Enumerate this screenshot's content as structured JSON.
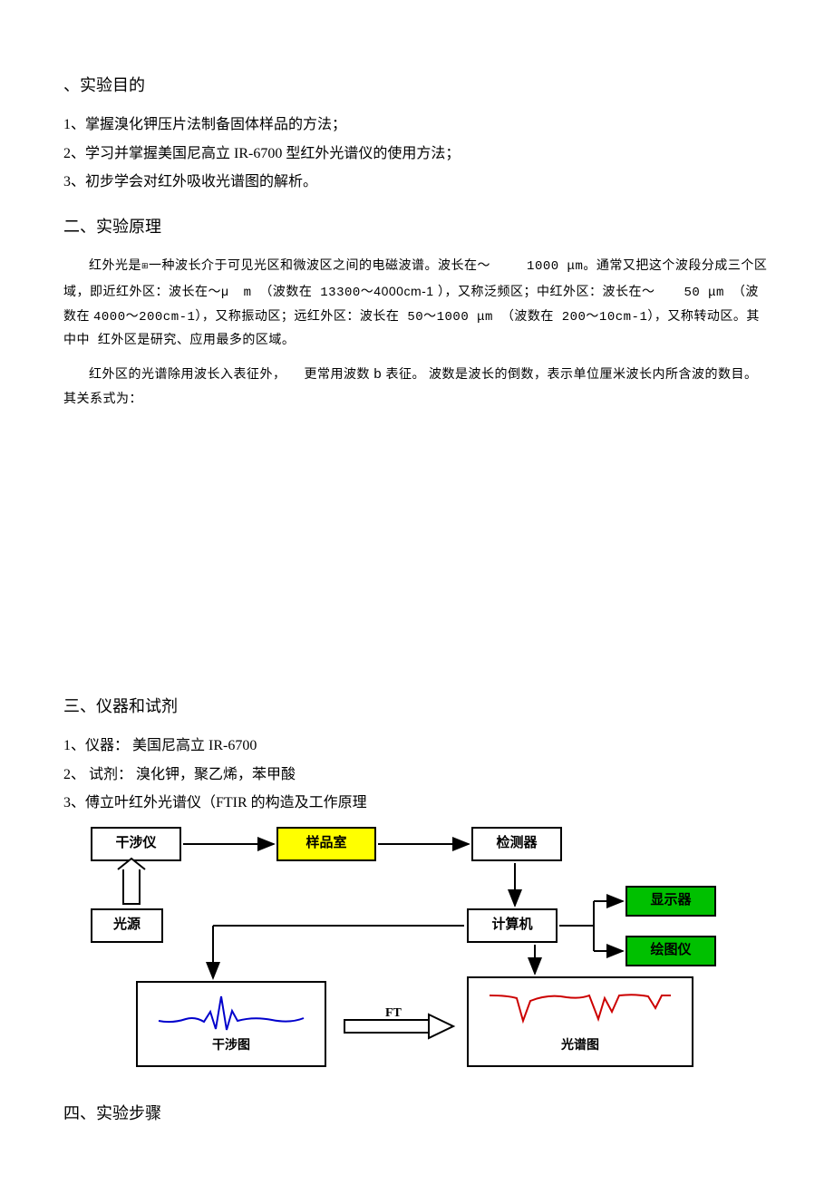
{
  "section1": {
    "title": "、实验目的",
    "items": [
      "1、掌握溴化钾压片法制备固体样品的方法；",
      "2、学习并掌握美国尼高立 IR-6700 型红外光谱仪的使用方法；",
      "3、初步学会对红外吸收光谱图的解析。"
    ]
  },
  "section2": {
    "title": "二、实验原理",
    "para1_a": "红外光是",
    "para1_b": "一种波长介于可见光区和微波区之间的电磁波谱。波长在",
    "para1_c": "～",
    "para1_d": "1000 μm。通常又把这个波段分成三个区域，即近红外区：波长在",
    "para1_e": "～μ",
    "para1_f": "m （波数在 13300",
    "para1_g": "～4000cm-1 ）",
    "para1_h": "，又称泛频区；中红外区：波长在",
    "para1_i": "～",
    "para1_j": "50 μm （波数在",
    "para1_k": "4000～200cm-1），又称振动区；远红外区：波长在 50～1000 μm （波数在 200～10cm-1），又称转动区。其中中 红外区是研究、应用最多的区域。",
    "para2_a": "红外区的光谱除用波长入表征外，",
    "para2_b": "更常用波数",
    "para2_c": "b",
    "para2_d": "表征。 波数是波长的倒数，表示单位厘米波长内所含波的数目。",
    "para2_e": "其关系式为："
  },
  "section3": {
    "title": "三、仪器和试剂",
    "items": [
      "1、仪器： 美国尼高立 IR-6700",
      "2、 试剂： 溴化钾，聚乙烯，苯甲酸",
      "3、傅立叶红外光谱仪（FTIR 的构造及工作原理"
    ]
  },
  "diagram": {
    "interferometer": "干涉仪",
    "sample_chamber": "样品室",
    "detector": "检测器",
    "light_source": "光源",
    "computer": "计算机",
    "display": "显示器",
    "plotter": "绘图仪",
    "interferogram": "干涉图",
    "ft": "FT",
    "spectrum": "光谱图"
  },
  "section4": {
    "title": "四、实验步骤"
  }
}
